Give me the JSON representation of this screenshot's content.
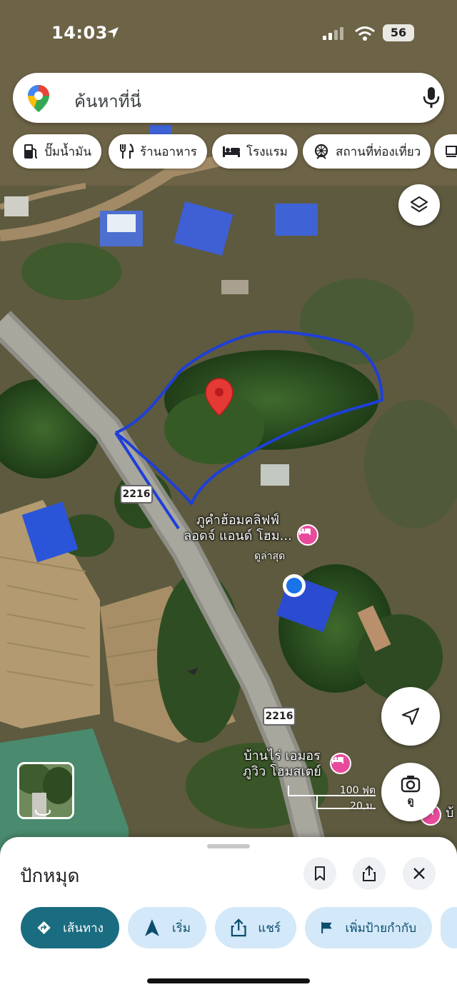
{
  "status_bar": {
    "time": "14:03",
    "battery": "56"
  },
  "search": {
    "placeholder": "ค้นหาที่นี่"
  },
  "chips": [
    {
      "label": "ปั๊มน้ำมัน",
      "icon": "gas-station-icon"
    },
    {
      "label": "ร้านอาหาร",
      "icon": "restaurant-icon"
    },
    {
      "label": "โรงแรม",
      "icon": "hotel-icon"
    },
    {
      "label": "สถานที่ท่องเที่ยว",
      "icon": "attraction-icon"
    }
  ],
  "map": {
    "road_shields": [
      "2216",
      "2216"
    ],
    "pois": [
      {
        "name_line1": "ภูคำฮ้อมคลิฟฟ์",
        "name_line2": "ลอดจ์ แอนด์ โฮม...",
        "sub": "ดูล่าสุด",
        "icon": "hotel-icon"
      },
      {
        "name_line1": "บ้านไร่ เอมอร",
        "name_line2": "ภูวิว โฮมสเตย์",
        "icon": "hotel-icon"
      }
    ],
    "edge_label": "บ้",
    "scale": {
      "feet": "100 ฟุต",
      "meters": "20 ม."
    },
    "layers_icon": "layers-icon",
    "navigate_icon": "navigation-arrow-icon",
    "lens_label": "ดู"
  },
  "sheet": {
    "title": "ปักหมุด",
    "actions": [
      {
        "label": "เส้นทาง",
        "icon": "directions-icon"
      },
      {
        "label": "เริ่ม",
        "icon": "start-navigation-icon"
      },
      {
        "label": "แชร์",
        "icon": "share-icon"
      },
      {
        "label": "เพิ่มป้ายกำกับ",
        "icon": "label-flag-icon"
      }
    ]
  },
  "colors": {
    "accent": "#1a6c80",
    "chip_bg": "#d3e8f8",
    "boundary": "#1e3fd8",
    "pin": "#e53935",
    "poi": "#e94b9c",
    "location_dot": "#1a73e8"
  }
}
